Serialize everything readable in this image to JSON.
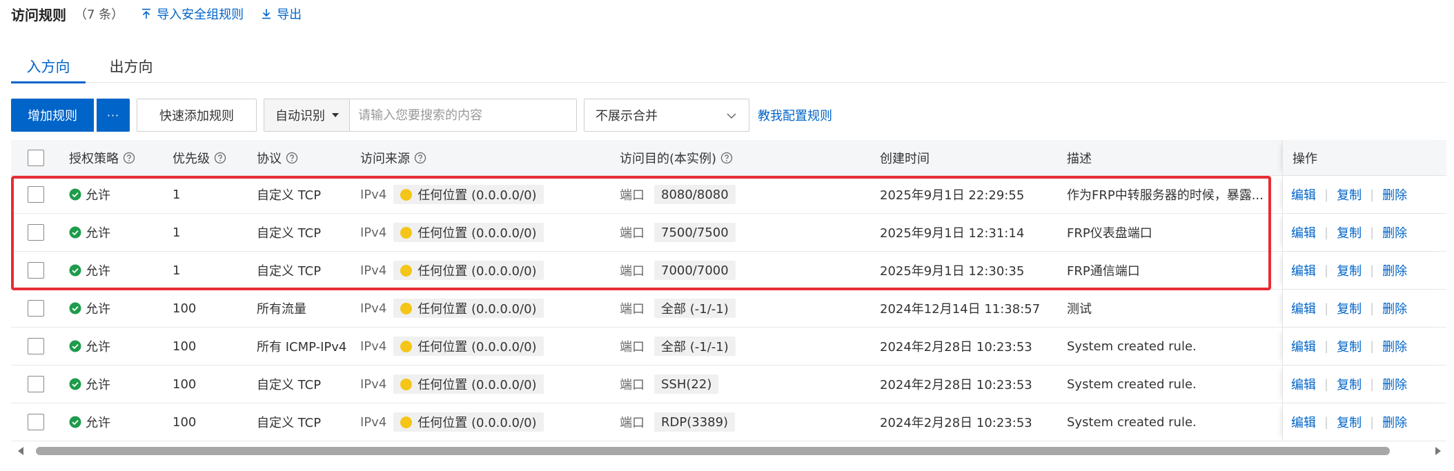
{
  "header": {
    "title": "访问规则",
    "count": "（7 条）",
    "import_label": "导入安全组规则",
    "export_label": "导出"
  },
  "tabs": [
    {
      "label": "入方向",
      "active": true
    },
    {
      "label": "出方向",
      "active": false
    }
  ],
  "toolbar": {
    "add_rule": "增加规则",
    "more": "···",
    "quick_add": "快速添加规则",
    "search_type": "自动识别",
    "search_placeholder": "请输入您要搜索的内容",
    "merge_select": "不展示合并",
    "help_link": "教我配置规则"
  },
  "table": {
    "columns": {
      "policy": "授权策略",
      "priority": "优先级",
      "protocol": "协议",
      "source": "访问来源",
      "dest": "访问目的(本实例)",
      "created": "创建时间",
      "desc": "描述",
      "ops": "操作"
    },
    "source_type": "IPv4",
    "port_label": "端口",
    "ops": {
      "edit": "编辑",
      "copy": "复制",
      "delete": "删除",
      "sep": "|"
    },
    "rows": [
      {
        "policy": "允许",
        "priority": "1",
        "protocol": "自定义 TCP",
        "source": "任何位置 (0.0.0.0/0)",
        "port": "8080/8080",
        "created": "2025年9月1日 22:29:55",
        "desc": "作为FRP中转服务器的时候，暴露..."
      },
      {
        "policy": "允许",
        "priority": "1",
        "protocol": "自定义 TCP",
        "source": "任何位置 (0.0.0.0/0)",
        "port": "7500/7500",
        "created": "2025年9月1日 12:31:14",
        "desc": "FRP仪表盘端口"
      },
      {
        "policy": "允许",
        "priority": "1",
        "protocol": "自定义 TCP",
        "source": "任何位置 (0.0.0.0/0)",
        "port": "7000/7000",
        "created": "2025年9月1日 12:30:35",
        "desc": "FRP通信端口"
      },
      {
        "policy": "允许",
        "priority": "100",
        "protocol": "所有流量",
        "source": "任何位置 (0.0.0.0/0)",
        "port": "全部 (-1/-1)",
        "created": "2024年12月14日 11:38:57",
        "desc": "测试"
      },
      {
        "policy": "允许",
        "priority": "100",
        "protocol": "所有 ICMP-IPv4",
        "source": "任何位置 (0.0.0.0/0)",
        "port": "全部 (-1/-1)",
        "created": "2024年2月28日 10:23:53",
        "desc": "System created rule."
      },
      {
        "policy": "允许",
        "priority": "100",
        "protocol": "自定义 TCP",
        "source": "任何位置 (0.0.0.0/0)",
        "port": "SSH(22)",
        "created": "2024年2月28日 10:23:53",
        "desc": "System created rule."
      },
      {
        "policy": "允许",
        "priority": "100",
        "protocol": "自定义 TCP",
        "source": "任何位置 (0.0.0.0/0)",
        "port": "RDP(3389)",
        "created": "2024年2月28日 10:23:53",
        "desc": "System created rule."
      }
    ]
  },
  "colors": {
    "primary": "#0064c8",
    "allow": "#1e9b4b",
    "warning": "#f5c518",
    "highlight": "#e52d35"
  },
  "icons": {
    "import": "arrow-up-icon",
    "export": "download-icon",
    "help": "question-circle-icon",
    "allow": "check-circle-icon",
    "source": "warning-dot-icon",
    "dropdown": "chevron-down-icon"
  }
}
